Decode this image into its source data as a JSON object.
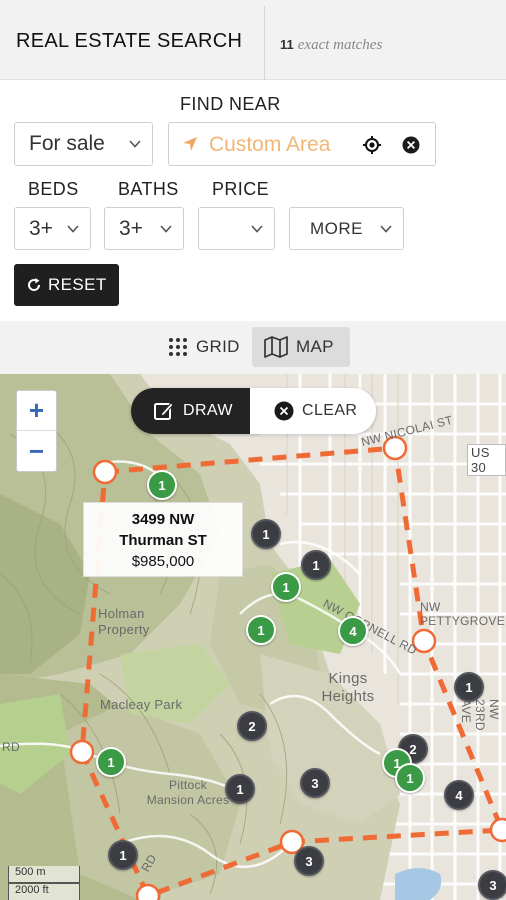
{
  "header": {
    "title": "REAL ESTATE SEARCH",
    "match_count": "11",
    "match_text": "exact matches"
  },
  "filters": {
    "find_near_label": "FIND NEAR",
    "listing_type": "For sale",
    "location_placeholder": "Custom Area",
    "beds_label": "BEDS",
    "beds_value": "3+",
    "baths_label": "BATHS",
    "baths_value": "3+",
    "price_label": "PRICE",
    "price_value": "",
    "more_label": "MORE",
    "reset_label": "RESET"
  },
  "view_toggle": {
    "grid_label": "GRID",
    "map_label": "MAP",
    "selected": "MAP"
  },
  "map": {
    "zoom_in": "+",
    "zoom_out": "−",
    "draw_label": "DRAW",
    "clear_label": "CLEAR",
    "popup": {
      "line1": "3499 NW",
      "line2": "Thurman ST",
      "price": "$985,000"
    },
    "labels": {
      "nicolai": "NW NICOLAI ST",
      "us30": "US 30",
      "pettygrove": "NW PETTYGROVE",
      "holman": "Holman Property",
      "macleay": "Macleay Park",
      "kings": "Kings Heights",
      "pittock": "Pittock Mansion Acres",
      "ave23": "NW 23RD AVE",
      "cornell": "NW CORNELL RD",
      "rd": "RD",
      "rd2": "RD"
    },
    "scale": [
      "500 m",
      "2000 ft"
    ],
    "markers": [
      {
        "count": "1",
        "type": "green"
      },
      {
        "count": "1",
        "type": "dark"
      },
      {
        "count": "1",
        "type": "dark"
      },
      {
        "count": "1",
        "type": "green"
      },
      {
        "count": "1",
        "type": "green"
      },
      {
        "count": "4",
        "type": "green"
      },
      {
        "count": "1",
        "type": "dark"
      },
      {
        "count": "2",
        "type": "dark"
      },
      {
        "count": "1",
        "type": "green"
      },
      {
        "count": "2",
        "type": "dark"
      },
      {
        "count": "1",
        "type": "green"
      },
      {
        "count": "1",
        "type": "green"
      },
      {
        "count": "1",
        "type": "dark"
      },
      {
        "count": "3",
        "type": "dark"
      },
      {
        "count": "4",
        "type": "dark"
      },
      {
        "count": "1",
        "type": "dark"
      },
      {
        "count": "3",
        "type": "dark"
      },
      {
        "count": "3",
        "type": "dark"
      }
    ],
    "colors": {
      "boundary": "#f06a35",
      "marker_green": "#3a9a45",
      "marker_dark": "#3b3d42",
      "accent_placeholder": "#f2b676"
    }
  }
}
